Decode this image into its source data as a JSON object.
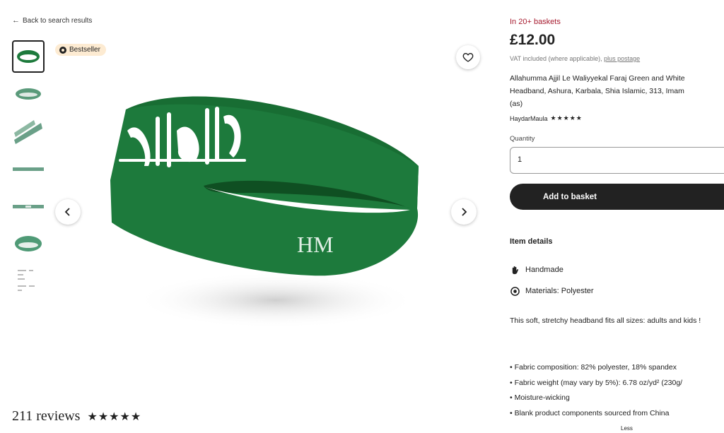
{
  "nav": {
    "back_label": "Back to search results"
  },
  "gallery": {
    "badge": "Bestseller",
    "band_color": "#1d7a3c",
    "logo_text": "HM",
    "thumb_count": 7
  },
  "reviews": {
    "label": "211 reviews",
    "stars": "★★★★★",
    "rating": 5
  },
  "listing": {
    "baskets": "In 20+ baskets",
    "price": "£12.00",
    "vat_text": "VAT included (where applicable),",
    "vat_link": "plus postage",
    "title": "Allahumma Ajjil Le Waliyyekal Faraj Green and White\nHeadband, Ashura, Karbala, Shia Islamic, 313, Imam\n(as)",
    "seller": "HaydarMaula",
    "seller_stars": "★★★★★",
    "quantity_label": "Quantity",
    "quantity_value": "1",
    "add_button": "Add to basket"
  },
  "details": {
    "heading": "Item details",
    "handmade": "Handmade",
    "materials": "Materials: Polyester",
    "description": "This soft, stretchy headband fits all sizes: adults and kids !",
    "bullets": [
      "• Fabric composition: 82% polyester, 18% spandex",
      "• Fabric weight (may vary by 5%): 6.78 oz/yd² (230g/",
      "• Moisture-wicking",
      "• Blank product components sourced from China"
    ],
    "less_label": "Less"
  },
  "colors": {
    "accent": "#a61a2e",
    "button": "#222222",
    "badge_bg": "#fdebd2",
    "product_green": "#1d7a3c"
  }
}
